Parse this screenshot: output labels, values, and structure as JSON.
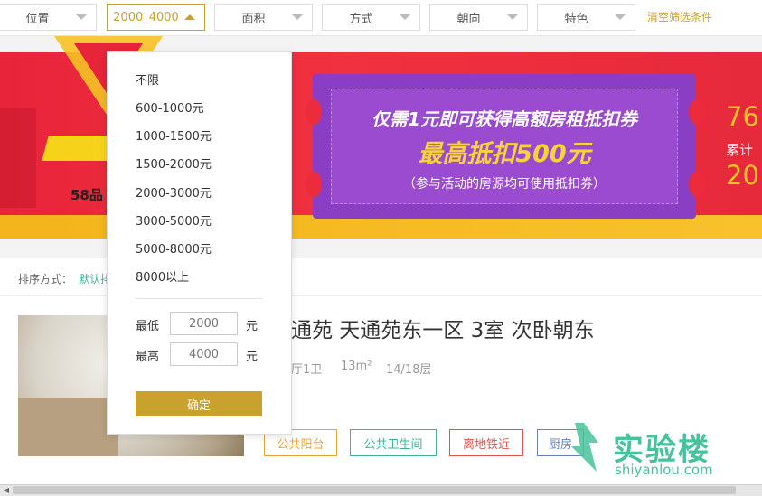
{
  "filters": [
    {
      "label": "位置",
      "active": false
    },
    {
      "label": "2000_4000",
      "active": true
    },
    {
      "label": "面积",
      "active": false
    },
    {
      "label": "方式",
      "active": false
    },
    {
      "label": "朝向",
      "active": false
    },
    {
      "label": "特色",
      "active": false
    }
  ],
  "clear_filters": "清空筛选条件",
  "banner": {
    "tag": "58品",
    "line1": "仅需1元即可获得高额房租抵扣券",
    "line2": "最高抵扣500元",
    "line3": "（参与活动的房源均可使用抵扣券）",
    "stat_top": "76",
    "stat_label": "累计",
    "stat_bottom": "20"
  },
  "sort": {
    "label": "排序方式：",
    "default": "默认排"
  },
  "listing": {
    "title": "通苑 天通苑东一区 3室 次卧朝东",
    "layout": "厅1卫",
    "area": "13m²",
    "floor": "14/18层",
    "tags": [
      {
        "label": "公共阳台",
        "color": "#e8a23a"
      },
      {
        "label": "公共卫生间",
        "color": "#3fb39a"
      },
      {
        "label": "离地铁近",
        "color": "#e0524f"
      },
      {
        "label": "厨房",
        "color": "#6a7fc1"
      }
    ]
  },
  "price_dropdown": {
    "options": [
      "不限",
      "600-1000元",
      "1000-1500元",
      "1500-2000元",
      "2000-3000元",
      "3000-5000元",
      "5000-8000元",
      "8000以上"
    ],
    "min_label": "最低",
    "min_value": "2000",
    "max_label": "最高",
    "max_value": "4000",
    "unit": "元",
    "confirm": "确定"
  },
  "watermark": {
    "cn": "实验楼",
    "en": "shiyanlou.com"
  },
  "colors": {
    "accent": "#c9a22d",
    "banner_red": "#e8243a",
    "ticket_purple": "#8a3ec4",
    "brand_green": "#46c39a"
  }
}
